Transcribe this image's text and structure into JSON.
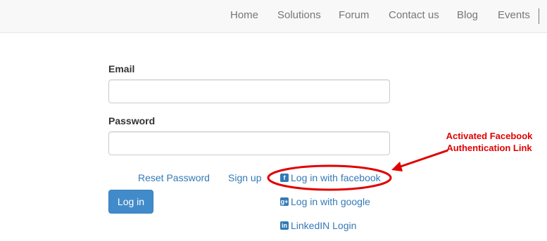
{
  "nav": {
    "items": [
      "Home",
      "Solutions",
      "Forum",
      "Contact us",
      "Blog",
      "Events"
    ]
  },
  "form": {
    "email_label": "Email",
    "email_value": "",
    "password_label": "Password",
    "password_value": "",
    "reset_password": "Reset Password",
    "sign_up": "Sign up",
    "login_button": "Log in"
  },
  "social": {
    "facebook": {
      "icon": "facebook-icon",
      "glyph": "f",
      "label": "Log in with facebook"
    },
    "google": {
      "icon": "google-plus-icon",
      "glyph": "g+",
      "label": "Log in with google"
    },
    "linkedin": {
      "icon": "linkedin-icon",
      "glyph": "in",
      "label": "LinkedIN Login"
    }
  },
  "annotation": {
    "line1": "Activated Facebook",
    "line2": "Authentication Link",
    "color": "#e00000"
  },
  "colors": {
    "link": "#337ab7",
    "button": "#428bca",
    "navbar_bg": "#f8f8f8"
  }
}
